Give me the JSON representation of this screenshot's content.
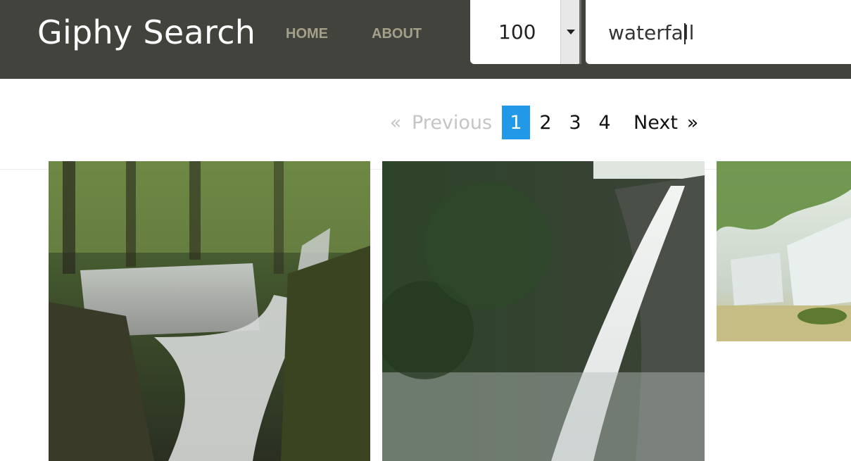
{
  "navbar": {
    "brand": "Giphy Search",
    "links": [
      {
        "label": "HOME"
      },
      {
        "label": "ABOUT"
      }
    ],
    "limit_select": {
      "value": "100"
    },
    "search": {
      "value": "waterfall"
    }
  },
  "pagination": {
    "prev_arrow": "«",
    "prev_label": "Previous",
    "pages": [
      "1",
      "2",
      "3",
      "4"
    ],
    "current_page": "1",
    "next_label": "Next",
    "next_arrow": "»"
  },
  "results": [
    {
      "kind": "waterfall-gif"
    },
    {
      "kind": "waterfall-gif"
    },
    {
      "kind": "waterfall-gif"
    }
  ],
  "colors": {
    "navbar_bg": "#43433d",
    "nav_link": "#a4a08a",
    "active_page": "#2199e8"
  }
}
